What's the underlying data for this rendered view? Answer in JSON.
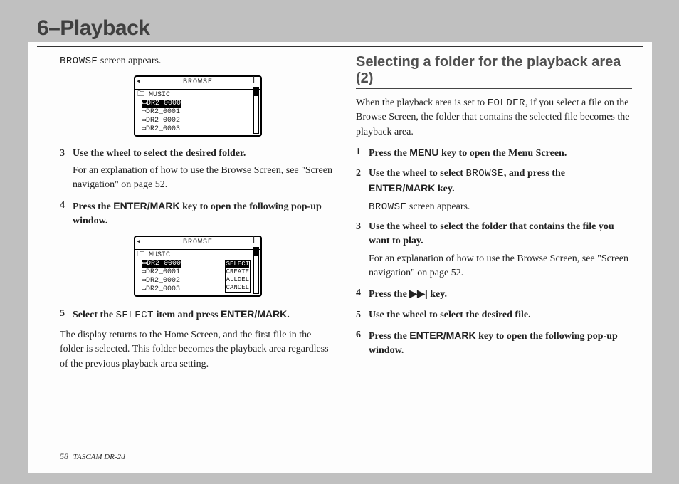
{
  "header": "6–Playback",
  "left": {
    "line1_pre": "BROWSE",
    "line1_post": " screen appears.",
    "fig1": {
      "title": "BROWSE",
      "root": "MUSIC",
      "items": [
        "DR2_0000",
        "DR2_0001",
        "DR2_0002",
        "DR2_0003"
      ],
      "selected": 0
    },
    "step3_num": "3",
    "step3_text": "Use the wheel to select the desired folder.",
    "step3_sub": "For an explanation of how to use the Browse Screen, see \"Screen navigation\" on page 52.",
    "step4_num": "4",
    "step4_a": "Press the ",
    "step4_key": "ENTER/MARK",
    "step4_b": " key to open the following pop-up window.",
    "fig2": {
      "title": "BROWSE",
      "root": "MUSIC",
      "items": [
        "DR2_0000",
        "DR2_0001",
        "DR2_0002",
        "DR2_0003"
      ],
      "selected": 0,
      "popup": [
        "SELECT",
        "CREATE",
        "ALLDEL",
        "CANCEL"
      ],
      "popup_sel": 0
    },
    "step5_num": "5",
    "step5_a": "Select the ",
    "step5_sel": "SELECT",
    "step5_b": " item and press ",
    "step5_key": "ENTER/MARK",
    "step5_c": ".",
    "para": "The display returns to the Home Screen, and the first file in the folder is selected. This folder becomes the playback area regardless of the previous playback area setting."
  },
  "right": {
    "heading": "Selecting a folder for the playback area (2)",
    "intro_a": "When the playback area is set to ",
    "intro_folder": "FOLDER",
    "intro_b": ", if you select a file on the Browse Screen, the folder that contains the selected file becomes the playback area.",
    "s1_num": "1",
    "s1_a": "Press the ",
    "s1_key": "MENU",
    "s1_b": " key to open the Menu Screen.",
    "s2_num": "2",
    "s2_a": "Use the wheel to select ",
    "s2_sel": "BROWSE",
    "s2_b": ", and press the ",
    "s2_key": "ENTER/MARK",
    "s2_c": " key.",
    "s2_sub_a": "BROWSE",
    "s2_sub_b": " screen appears.",
    "s3_num": "3",
    "s3_text": "Use the wheel to select the folder that contains the file you want to play.",
    "s3_sub": "For an explanation of how to use the Browse Screen, see \"Screen navigation\" on page 52.",
    "s4_num": "4",
    "s4_a": "Press the ",
    "s4_icon": "▶▶|",
    "s4_b": " key.",
    "s5_num": "5",
    "s5_text": "Use the wheel to select the desired file.",
    "s6_num": "6",
    "s6_a": "Press the ",
    "s6_key": "ENTER/MARK",
    "s6_b": " key to open the following pop-up window."
  },
  "footer": {
    "page": "58",
    "label": "TASCAM  DR-2d"
  }
}
